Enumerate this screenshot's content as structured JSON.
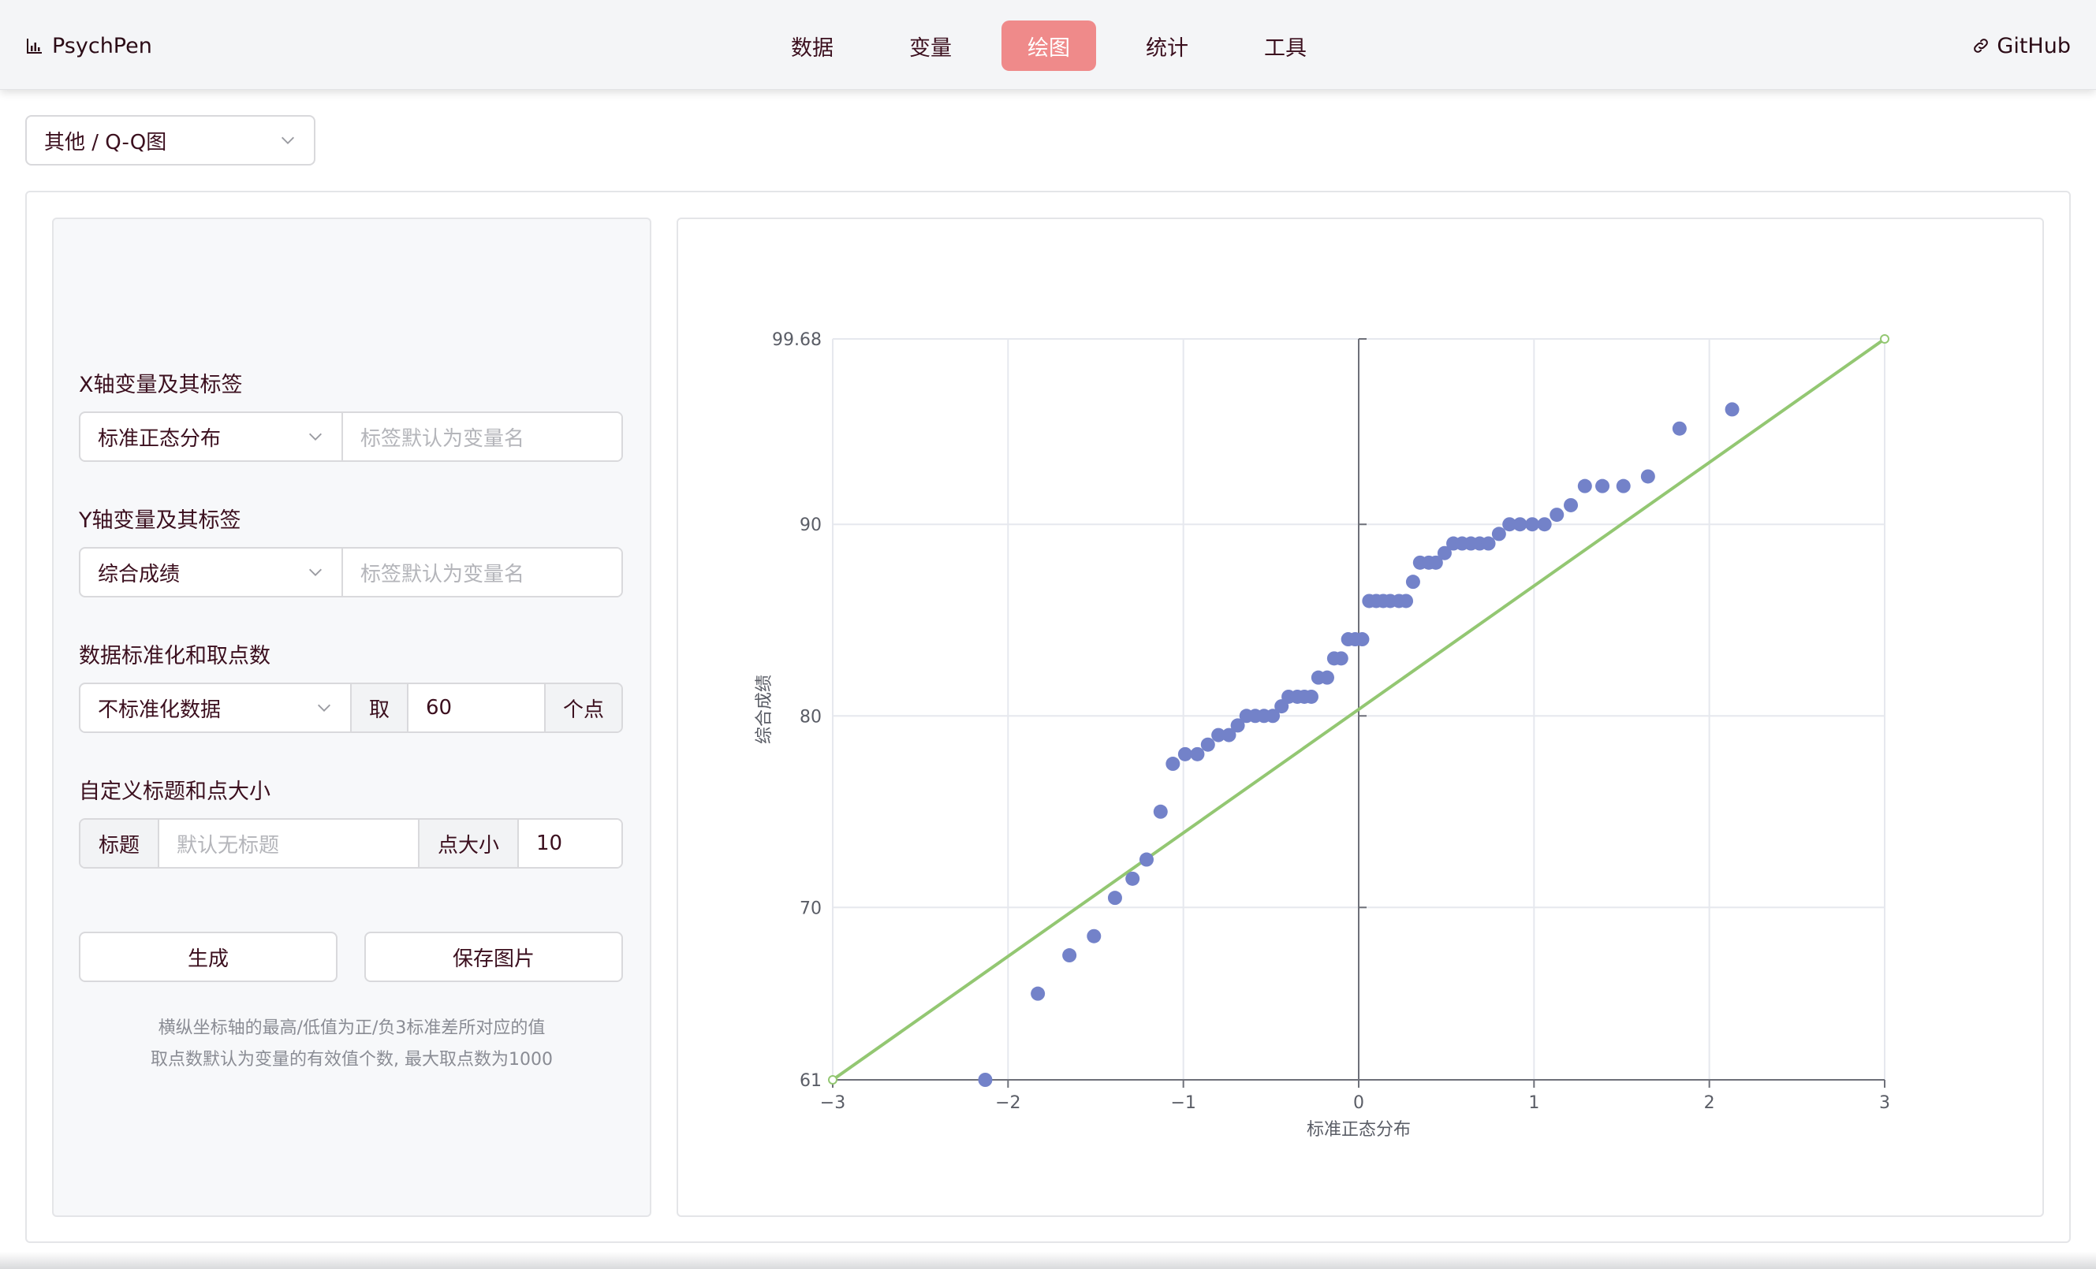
{
  "header": {
    "brand": "PsychPen",
    "brand_icon": "bar-chart-icon",
    "nav": [
      {
        "label": "数据",
        "active": false
      },
      {
        "label": "变量",
        "active": false
      },
      {
        "label": "绘图",
        "active": true
      },
      {
        "label": "统计",
        "active": false
      },
      {
        "label": "工具",
        "active": false
      }
    ],
    "github": "GitHub",
    "accent": "#ef8a8a"
  },
  "plot_type": {
    "value": "其他 / Q-Q图"
  },
  "form": {
    "x_section": "X轴变量及其标签",
    "x_variable": "标准正态分布",
    "x_label_placeholder": "标签默认为变量名",
    "y_section": "Y轴变量及其标签",
    "y_variable": "综合成绩",
    "y_label_placeholder": "标签默认为变量名",
    "std_section": "数据标准化和取点数",
    "std_option": "不标准化数据",
    "take_label": "取",
    "points": "60",
    "points_unit": "个点",
    "custom_section": "自定义标题和点大小",
    "title_label": "标题",
    "title_placeholder": "默认无标题",
    "size_label": "点大小",
    "size_value": "10",
    "generate": "生成",
    "save": "保存图片",
    "hint1": "横纵坐标轴的最高/低值为正/负3标准差所对应的值",
    "hint2": "取点数默认为变量的有效值个数, 最大取点数为1000"
  },
  "chart_data": {
    "type": "scatter",
    "xlabel": "标准正态分布",
    "ylabel": "综合成绩",
    "xlim": [
      -3,
      3
    ],
    "ylim": [
      61,
      99.68
    ],
    "xticks": [
      "−3",
      "−2",
      "−1",
      "0",
      "1",
      "2",
      "3"
    ],
    "yticks": [
      "61",
      "70",
      "80",
      "90",
      "99.68"
    ],
    "grid": true,
    "point_color": "#7382c9",
    "line_color": "#93c772",
    "reference_line": {
      "x": [
        -3,
        3
      ],
      "y": [
        61,
        99.68
      ]
    },
    "points": [
      {
        "x": -2.13,
        "y": 61
      },
      {
        "x": -1.83,
        "y": 65.5
      },
      {
        "x": -1.65,
        "y": 67.5
      },
      {
        "x": -1.51,
        "y": 68.5
      },
      {
        "x": -1.39,
        "y": 70.5
      },
      {
        "x": -1.29,
        "y": 71.5
      },
      {
        "x": -1.21,
        "y": 72.5
      },
      {
        "x": -1.13,
        "y": 75
      },
      {
        "x": -1.06,
        "y": 77.5
      },
      {
        "x": -0.99,
        "y": 78
      },
      {
        "x": -0.92,
        "y": 78
      },
      {
        "x": -0.86,
        "y": 78.5
      },
      {
        "x": -0.8,
        "y": 79
      },
      {
        "x": -0.74,
        "y": 79
      },
      {
        "x": -0.69,
        "y": 79.5
      },
      {
        "x": -0.64,
        "y": 80
      },
      {
        "x": -0.59,
        "y": 80
      },
      {
        "x": -0.54,
        "y": 80
      },
      {
        "x": -0.49,
        "y": 80
      },
      {
        "x": -0.44,
        "y": 80.5
      },
      {
        "x": -0.4,
        "y": 81
      },
      {
        "x": -0.35,
        "y": 81
      },
      {
        "x": -0.31,
        "y": 81
      },
      {
        "x": -0.27,
        "y": 81
      },
      {
        "x": -0.23,
        "y": 82
      },
      {
        "x": -0.18,
        "y": 82
      },
      {
        "x": -0.14,
        "y": 83
      },
      {
        "x": -0.1,
        "y": 83
      },
      {
        "x": -0.06,
        "y": 84
      },
      {
        "x": -0.02,
        "y": 84
      },
      {
        "x": 0.02,
        "y": 84
      },
      {
        "x": 0.06,
        "y": 86
      },
      {
        "x": 0.1,
        "y": 86
      },
      {
        "x": 0.14,
        "y": 86
      },
      {
        "x": 0.18,
        "y": 86
      },
      {
        "x": 0.23,
        "y": 86
      },
      {
        "x": 0.27,
        "y": 86
      },
      {
        "x": 0.31,
        "y": 87
      },
      {
        "x": 0.35,
        "y": 88
      },
      {
        "x": 0.4,
        "y": 88
      },
      {
        "x": 0.44,
        "y": 88
      },
      {
        "x": 0.49,
        "y": 88.5
      },
      {
        "x": 0.54,
        "y": 89
      },
      {
        "x": 0.59,
        "y": 89
      },
      {
        "x": 0.64,
        "y": 89
      },
      {
        "x": 0.69,
        "y": 89
      },
      {
        "x": 0.74,
        "y": 89
      },
      {
        "x": 0.8,
        "y": 89.5
      },
      {
        "x": 0.86,
        "y": 90
      },
      {
        "x": 0.92,
        "y": 90
      },
      {
        "x": 0.99,
        "y": 90
      },
      {
        "x": 1.06,
        "y": 90
      },
      {
        "x": 1.13,
        "y": 90.5
      },
      {
        "x": 1.21,
        "y": 91
      },
      {
        "x": 1.29,
        "y": 92
      },
      {
        "x": 1.39,
        "y": 92
      },
      {
        "x": 1.51,
        "y": 92
      },
      {
        "x": 1.65,
        "y": 92.5
      },
      {
        "x": 1.83,
        "y": 95
      },
      {
        "x": 2.13,
        "y": 96
      }
    ]
  }
}
